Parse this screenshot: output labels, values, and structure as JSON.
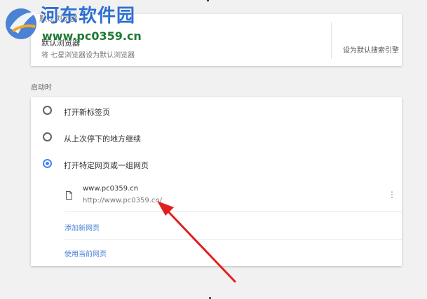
{
  "watermark": {
    "title": "河东软件园",
    "url": "www.pc0359.cn"
  },
  "default_browser": {
    "section_label": "默认浏览器",
    "title": "默认浏览器",
    "subtitle": "将 七星浏览器设为默认浏览器",
    "set_default_button": "设为默认搜索引擎"
  },
  "startup": {
    "section_label": "启动时",
    "options": [
      {
        "label": "打开新标签页",
        "selected": false
      },
      {
        "label": "从上次停下的地方继续",
        "selected": false
      },
      {
        "label": "打开特定网页或一组网页",
        "selected": true
      }
    ],
    "page": {
      "name": "www.pc0359.cn",
      "url": "http://www.pc0359.cn/"
    },
    "add_page_link": "添加新网页",
    "use_current_link": "使用当前网页"
  },
  "colors": {
    "accent": "#4285f4",
    "link": "#4a7fd8",
    "arrow": "#e02020"
  }
}
